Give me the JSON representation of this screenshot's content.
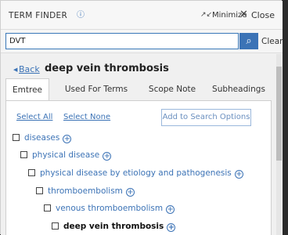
{
  "header": {
    "title": "TERM FINDER",
    "help_icon": "question-circle-icon",
    "minimize_label": "Minimize",
    "close_label": "Close"
  },
  "search": {
    "value": "DVT",
    "clear_label": "Clear"
  },
  "detail": {
    "back_label": "Back",
    "term": "deep vein thrombosis",
    "tabs": [
      "Emtree",
      "Used For Terms",
      "Scope Note",
      "Subheadings"
    ],
    "active_tab": "Emtree",
    "select_all": "Select All",
    "select_none": "Select None",
    "add_button": "Add to Search Options"
  },
  "tree": [
    {
      "label": "diseases"
    },
    {
      "label": "physical disease"
    },
    {
      "label": "physical disease by etiology and pathogenesis"
    },
    {
      "label": "thromboembolism"
    },
    {
      "label": "venous thromboembolism"
    },
    {
      "label": "deep vein thrombosis",
      "current": true
    }
  ],
  "colors": {
    "accent": "#3c73b6",
    "background": "#f0f0f0"
  }
}
